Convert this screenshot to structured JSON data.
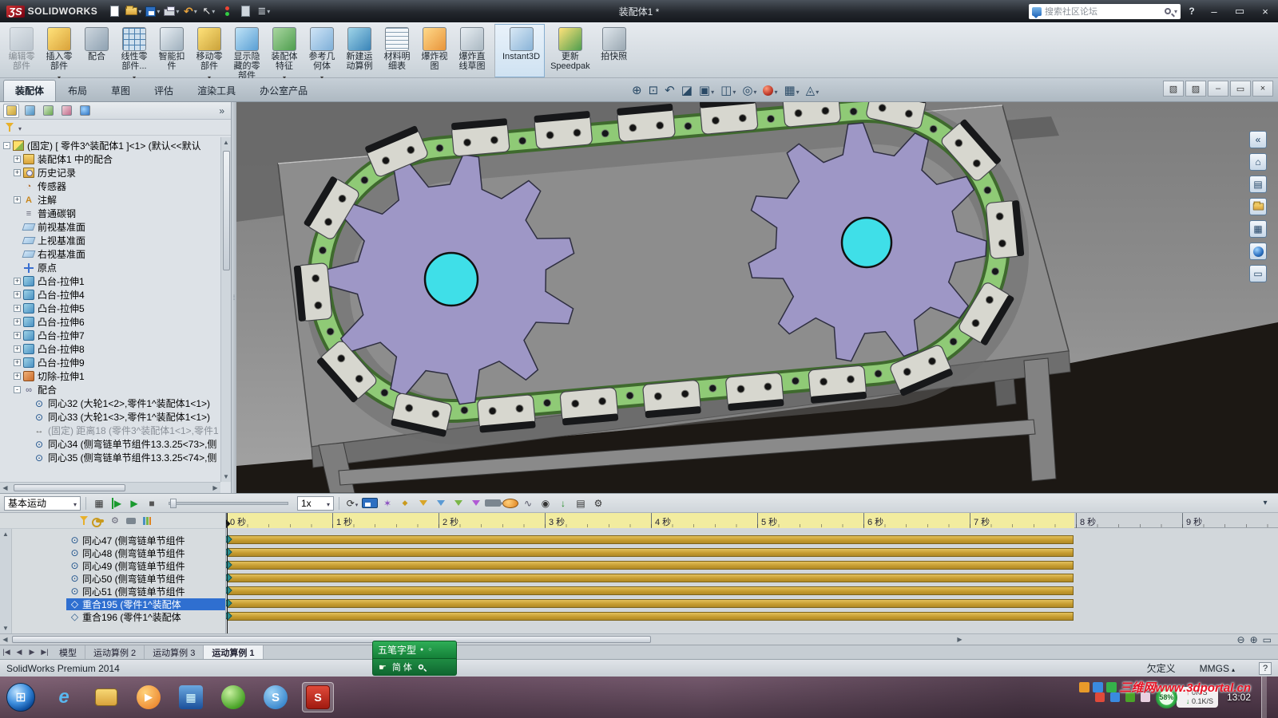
{
  "titlebar": {
    "logo_mark": "ƷS",
    "logo_text": "SOLIDWORKS",
    "doc_title": "装配体1 *",
    "search_placeholder": "搜索社区论坛",
    "help": "?",
    "window_controls": {
      "min": "–",
      "restore": "▭",
      "close": "×"
    }
  },
  "ribbon": {
    "buttons": [
      {
        "name": "edit-component-button",
        "label": "编辑零\n部件",
        "icon": "edit",
        "disabled": true
      },
      {
        "name": "insert-component-button",
        "label": "插入零\n部件",
        "icon": "insert",
        "arrow": true
      },
      {
        "name": "mate-button",
        "label": "配合",
        "icon": "mate"
      },
      {
        "name": "linear-component-pattern-button",
        "label": "线性零\n部件...",
        "icon": "pattern",
        "arrow": true
      },
      {
        "name": "smart-fasteners-button",
        "label": "智能扣\n件",
        "icon": "fastener"
      },
      {
        "name": "move-component-button",
        "label": "移动零\n部件",
        "icon": "move",
        "arrow": true
      },
      {
        "name": "show-hidden-components-button",
        "label": "显示隐\n藏的零\n部件",
        "icon": "showhide"
      },
      {
        "name": "assembly-features-button",
        "label": "装配体\n特征",
        "icon": "asmfeat",
        "arrow": true
      },
      {
        "name": "reference-geometry-button",
        "label": "参考几\n何体",
        "icon": "refgeo",
        "arrow": true
      },
      {
        "name": "new-motion-study-button",
        "label": "新建运\n动算例",
        "icon": "motion"
      },
      {
        "name": "bill-of-materials-button",
        "label": "材料明\n细表",
        "icon": "bom"
      },
      {
        "name": "exploded-view-button",
        "label": "爆炸视\n图",
        "icon": "explode"
      },
      {
        "name": "explode-line-sketch-button",
        "label": "爆炸直\n线草图",
        "icon": "explodeline"
      },
      {
        "name": "instant3d-button",
        "label": "Instant3D",
        "icon": "instant3d",
        "active": true,
        "sep": true
      },
      {
        "name": "update-speedpak-button",
        "label": "更新\nSpeedpak",
        "icon": "speedpak"
      },
      {
        "name": "take-snapshot-button",
        "label": "拍快照",
        "icon": "snapshot"
      }
    ],
    "tabs": [
      {
        "name": "tab-assembly",
        "label": "装配体",
        "active": true
      },
      {
        "name": "tab-layout",
        "label": "布局"
      },
      {
        "name": "tab-sketch",
        "label": "草图"
      },
      {
        "name": "tab-evaluate",
        "label": "评估"
      },
      {
        "name": "tab-render-tools",
        "label": "渲染工具"
      },
      {
        "name": "tab-office-products",
        "label": "办公室产品"
      }
    ]
  },
  "hud": {
    "icons": [
      {
        "name": "zoom-fit-icon",
        "glyph": "⊕"
      },
      {
        "name": "zoom-area-icon",
        "glyph": "⊡"
      },
      {
        "name": "previous-view-icon",
        "glyph": "↶"
      },
      {
        "name": "section-view-icon",
        "glyph": "◪"
      },
      {
        "name": "view-orientation-icon",
        "glyph": "▣",
        "arrow": true
      },
      {
        "name": "display-style-icon",
        "glyph": "◫",
        "arrow": true
      },
      {
        "name": "hide-show-items-icon",
        "glyph": "◎",
        "arrow": true
      },
      {
        "name": "edit-appearance-icon",
        "cls": "ball",
        "arrow": true
      },
      {
        "name": "apply-scene-icon",
        "glyph": "▦",
        "arrow": true
      },
      {
        "name": "view-settings-icon",
        "glyph": "◬",
        "arrow": true
      }
    ]
  },
  "fpanel": {
    "chevron": "»",
    "tree": [
      {
        "name": "tree-root-part",
        "level": 0,
        "expand": "-",
        "icon": "part",
        "label": "(固定) [ 零件3^装配体1 ]<1> (默认<<默认"
      },
      {
        "name": "tree-mates-in-assembly",
        "level": 1,
        "expand": "+",
        "icon": "matefolder",
        "label": "装配体1 中的配合"
      },
      {
        "name": "tree-history",
        "level": 1,
        "expand": "+",
        "icon": "history",
        "label": "历史记录"
      },
      {
        "name": "tree-sensors",
        "level": 1,
        "expand": "",
        "icon": "sensor",
        "label": "传感器"
      },
      {
        "name": "tree-annotations",
        "level": 1,
        "expand": "+",
        "icon": "note",
        "label": "注解"
      },
      {
        "name": "tree-material",
        "level": 1,
        "expand": "",
        "icon": "material",
        "label": "普通碳钢"
      },
      {
        "name": "tree-front-plane",
        "level": 1,
        "expand": "",
        "icon": "plane",
        "label": "前视基准面"
      },
      {
        "name": "tree-top-plane",
        "level": 1,
        "expand": "",
        "icon": "plane",
        "label": "上视基准面"
      },
      {
        "name": "tree-right-plane",
        "level": 1,
        "expand": "",
        "icon": "plane",
        "label": "右视基准面"
      },
      {
        "name": "tree-origin",
        "level": 1,
        "expand": "",
        "icon": "origin",
        "label": "原点"
      },
      {
        "name": "tree-boss-extrude1",
        "level": 1,
        "expand": "+",
        "icon": "extrude",
        "label": "凸台-拉伸1"
      },
      {
        "name": "tree-boss-extrude4",
        "level": 1,
        "expand": "+",
        "icon": "extrude",
        "label": "凸台-拉伸4"
      },
      {
        "name": "tree-boss-extrude5",
        "level": 1,
        "expand": "+",
        "icon": "extrude",
        "label": "凸台-拉伸5"
      },
      {
        "name": "tree-boss-extrude6",
        "level": 1,
        "expand": "+",
        "icon": "extrude",
        "label": "凸台-拉伸6"
      },
      {
        "name": "tree-boss-extrude7",
        "level": 1,
        "expand": "+",
        "icon": "extrude",
        "label": "凸台-拉伸7"
      },
      {
        "name": "tree-boss-extrude8",
        "level": 1,
        "expand": "+",
        "icon": "extrude",
        "label": "凸台-拉伸8"
      },
      {
        "name": "tree-boss-extrude9",
        "level": 1,
        "expand": "+",
        "icon": "extrude",
        "label": "凸台-拉伸9"
      },
      {
        "name": "tree-cut-extrude1",
        "level": 1,
        "expand": "+",
        "icon": "cut",
        "label": "切除-拉伸1"
      },
      {
        "name": "tree-mates-folder",
        "level": 1,
        "expand": "-",
        "icon": "mates",
        "label": "配合"
      },
      {
        "name": "tree-mate-concentric32",
        "level": 2,
        "expand": "",
        "icon": "concentric",
        "label": "同心32 (大轮1<2>,零件1^装配体1<1>)"
      },
      {
        "name": "tree-mate-concentric33",
        "level": 2,
        "expand": "",
        "icon": "concentric",
        "label": "同心33 (大轮1<3>,零件1^装配体1<1>)"
      },
      {
        "name": "tree-mate-distance18",
        "level": 2,
        "expand": "",
        "icon": "distance",
        "label": "(固定) 距离18 (零件3^装配体1<1>,零件1",
        "muted": true
      },
      {
        "name": "tree-mate-concentric34",
        "level": 2,
        "expand": "",
        "icon": "concentric",
        "label": "同心34 (侧弯链单节组件13.3.25<73>,侧"
      },
      {
        "name": "tree-mate-concentric35",
        "level": 2,
        "expand": "",
        "icon": "concentric",
        "label": "同心35 (侧弯链单节组件13.3.25<74>,侧"
      }
    ]
  },
  "motion": {
    "study_type": "基本运动",
    "speed": "1x",
    "transport": [
      {
        "name": "calculate-icon",
        "glyph": "▦"
      },
      {
        "name": "play-from-start-icon",
        "glyph": "▶",
        "cls": "fromstart"
      },
      {
        "name": "play-icon",
        "glyph": "▶",
        "cls": "play"
      },
      {
        "name": "stop-icon",
        "glyph": "■",
        "cls": "stop"
      }
    ],
    "tools": [
      {
        "name": "playback-mode-icon",
        "glyph": "⟳",
        "arrow": true
      },
      {
        "name": "save-animation-icon",
        "cls": "floppy"
      },
      {
        "name": "animation-wizard-icon",
        "glyph": "✶",
        "cls": "wiz"
      },
      {
        "name": "auto-key-icon",
        "glyph": "◆",
        "cls": "key"
      },
      {
        "name": "filter-none-icon",
        "cls": "funnel",
        "shape": true
      },
      {
        "name": "filter-animated-icon",
        "cls": "funnel2",
        "shape": true
      },
      {
        "name": "filter-driving-icon",
        "cls": "funnel3",
        "shape": true
      },
      {
        "name": "filter-selected-icon",
        "cls": "funnel4",
        "shape": true
      },
      {
        "name": "camera-icon",
        "cls": "cam"
      },
      {
        "name": "motor-icon",
        "cls": "motor"
      },
      {
        "name": "spring-icon",
        "glyph": "∿",
        "cls": "spring"
      },
      {
        "name": "contact-icon",
        "glyph": "◉"
      },
      {
        "name": "gravity-icon",
        "glyph": "↓",
        "cls": "grav"
      },
      {
        "name": "results-icon",
        "glyph": "▤"
      },
      {
        "name": "motion-properties-icon",
        "glyph": "⚙"
      }
    ],
    "collapse": "▾",
    "ruler": [
      "0 秒",
      "1 秒",
      "2 秒",
      "3 秒",
      "4 秒",
      "5 秒",
      "6 秒",
      "7 秒",
      "8 秒",
      "9 秒"
    ],
    "rows": [
      {
        "icon": "concentric",
        "label": "同心47 (侧弯链单节组件"
      },
      {
        "icon": "concentric",
        "label": "同心48 (侧弯链单节组件"
      },
      {
        "icon": "concentric",
        "label": "同心49 (侧弯链单节组件"
      },
      {
        "icon": "concentric",
        "label": "同心50 (侧弯链单节组件"
      },
      {
        "icon": "concentric",
        "label": "同心51 (侧弯链单节组件"
      },
      {
        "icon": "coincident",
        "label": "重合195 (零件1^装配体",
        "selected": true
      },
      {
        "icon": "coincident",
        "label": "重合196 (零件1^装配体"
      }
    ]
  },
  "studytabs": {
    "nav": [
      "|◀",
      "◀",
      "▶",
      "▶|"
    ],
    "tabs": [
      {
        "name": "tab-model",
        "label": "模型"
      },
      {
        "name": "tab-motion-study-2",
        "label": "运动算例 2"
      },
      {
        "name": "tab-motion-study-3",
        "label": "运动算例 3"
      },
      {
        "name": "tab-motion-study-1",
        "label": "运动算例 1",
        "active": true
      }
    ]
  },
  "statusbar": {
    "product": "SolidWorks Premium 2014",
    "state": "欠定义",
    "units": "MMGS",
    "help": "?"
  },
  "taskbar": {
    "apps": [
      {
        "name": "internet-explorer-icon",
        "glyph": "e",
        "cls": "ie"
      },
      {
        "name": "windows-explorer-icon",
        "cls": "folder"
      },
      {
        "name": "media-player-icon",
        "glyph": "▶",
        "cls": "wmp"
      },
      {
        "name": "blue-app-icon",
        "glyph": "▦",
        "cls": "blueapp"
      },
      {
        "name": "browser-360-icon",
        "cls": "green"
      },
      {
        "name": "solidworks-launcher-icon",
        "glyph": "S",
        "cls": "sblue"
      },
      {
        "name": "solidworks-running-icon",
        "glyph": "S",
        "cls": "sw",
        "active": true
      }
    ],
    "net_up": "0K/S",
    "net_down": "0.1K/S",
    "battery": "58%",
    "clock": "13:02"
  },
  "watermark": {
    "text": "三维网www.3dportal.cn"
  },
  "ime": {
    "name": "五笔字型",
    "dots": "● ○",
    "mode": "简 体"
  },
  "scene": {
    "chain_green": "#8fca76",
    "chain_dark": "#3f6a2e",
    "sprocket_purple": "#9e97c6",
    "sprocket_edge": "#2e2e40",
    "hub_cyan": "#3fdfe8",
    "plate_gray": "#d7d7cf",
    "plate_cap": "#17181a",
    "bar_gold": "#c49a2e",
    "bar_light": "#e3c05c",
    "selection_blue": "#2f6fd0"
  }
}
